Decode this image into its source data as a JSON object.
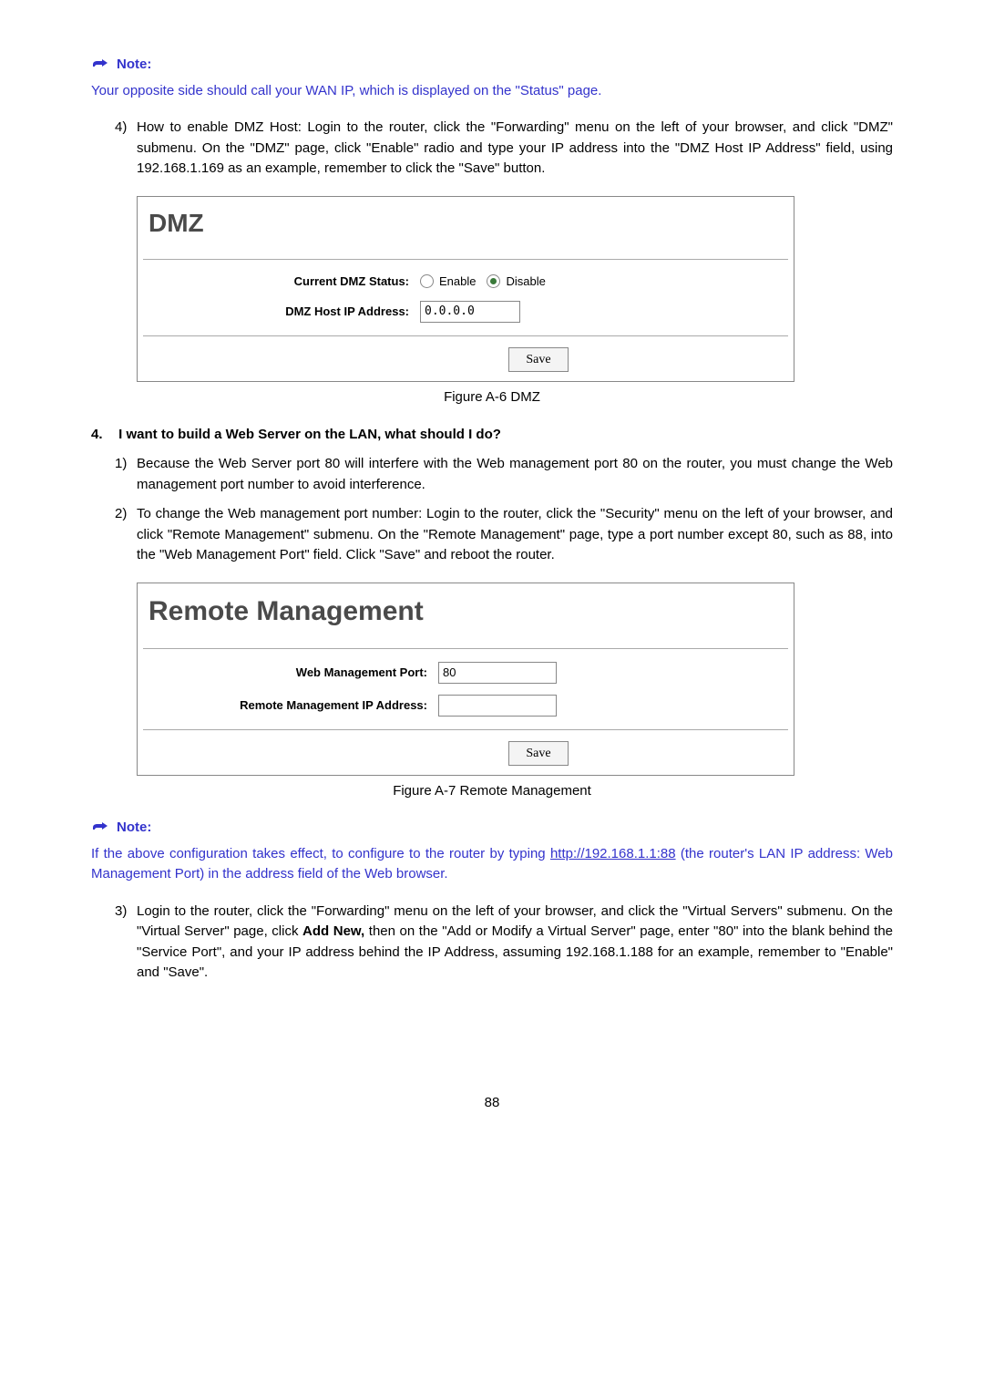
{
  "note1": {
    "label": "Note:",
    "text": "Your opposite side should call your WAN IP, which is displayed on the \"Status\" page."
  },
  "list1": {
    "item4_num": "4)",
    "item4_text": "How to enable DMZ Host: Login to the router, click the \"Forwarding\" menu on the left of your browser, and click \"DMZ\" submenu. On the \"DMZ\" page, click \"Enable\" radio and type your IP address into the \"DMZ Host IP Address\" field, using 192.168.1.169 as an example, remember to click the \"Save\" button."
  },
  "dmz_panel": {
    "title": "DMZ",
    "status_label": "Current DMZ Status:",
    "enable_label": "Enable",
    "disable_label": "Disable",
    "ip_label": "DMZ Host IP Address:",
    "ip_value": "0.0.0.0",
    "save_label": "Save",
    "caption": "Figure A-6 DMZ"
  },
  "q4": {
    "num": "4.",
    "text": "I want to build a Web Server on the LAN, what should I do?",
    "item1_num": "1)",
    "item1_text": "Because the Web Server port 80 will interfere with the Web management port 80 on the router, you must change the Web management port number to avoid interference.",
    "item2_num": "2)",
    "item2_text": "To change the Web management port number: Login to the router, click the \"Security\" menu on the left of your browser, and click \"Remote Management\" submenu. On the \"Remote Management\" page, type a port number except 80, such as 88, into the \"Web Management Port\" field. Click \"Save\" and reboot the router."
  },
  "rm_panel": {
    "title": "Remote Management",
    "port_label": "Web Management Port:",
    "port_value": "80",
    "ip_label": "Remote Management IP Address:",
    "ip_value": "",
    "save_label": "Save",
    "caption": "Figure A-7 Remote Management"
  },
  "note2": {
    "label": "Note:",
    "text_before": "If the above configuration takes effect, to configure to the router by typing ",
    "link": "http://192.168.1.1:88",
    "text_after": " (the router's LAN IP address: Web Management Port) in the address field of the Web browser."
  },
  "list3": {
    "item3_num": "3)",
    "item3_prefix": "Login to the router, click the \"Forwarding\" menu on the left of your browser, and click the \"Virtual Servers\" submenu. On the \"Virtual Server\" page, click ",
    "item3_bold": "Add New,",
    "item3_suffix": " then on the \"Add or Modify a Virtual Server\" page, enter \"80\" into the blank behind the \"Service Port\", and your IP address behind the IP Address, assuming 192.168.1.188 for an example, remember to \"Enable\" and \"Save\"."
  },
  "page_number": "88"
}
